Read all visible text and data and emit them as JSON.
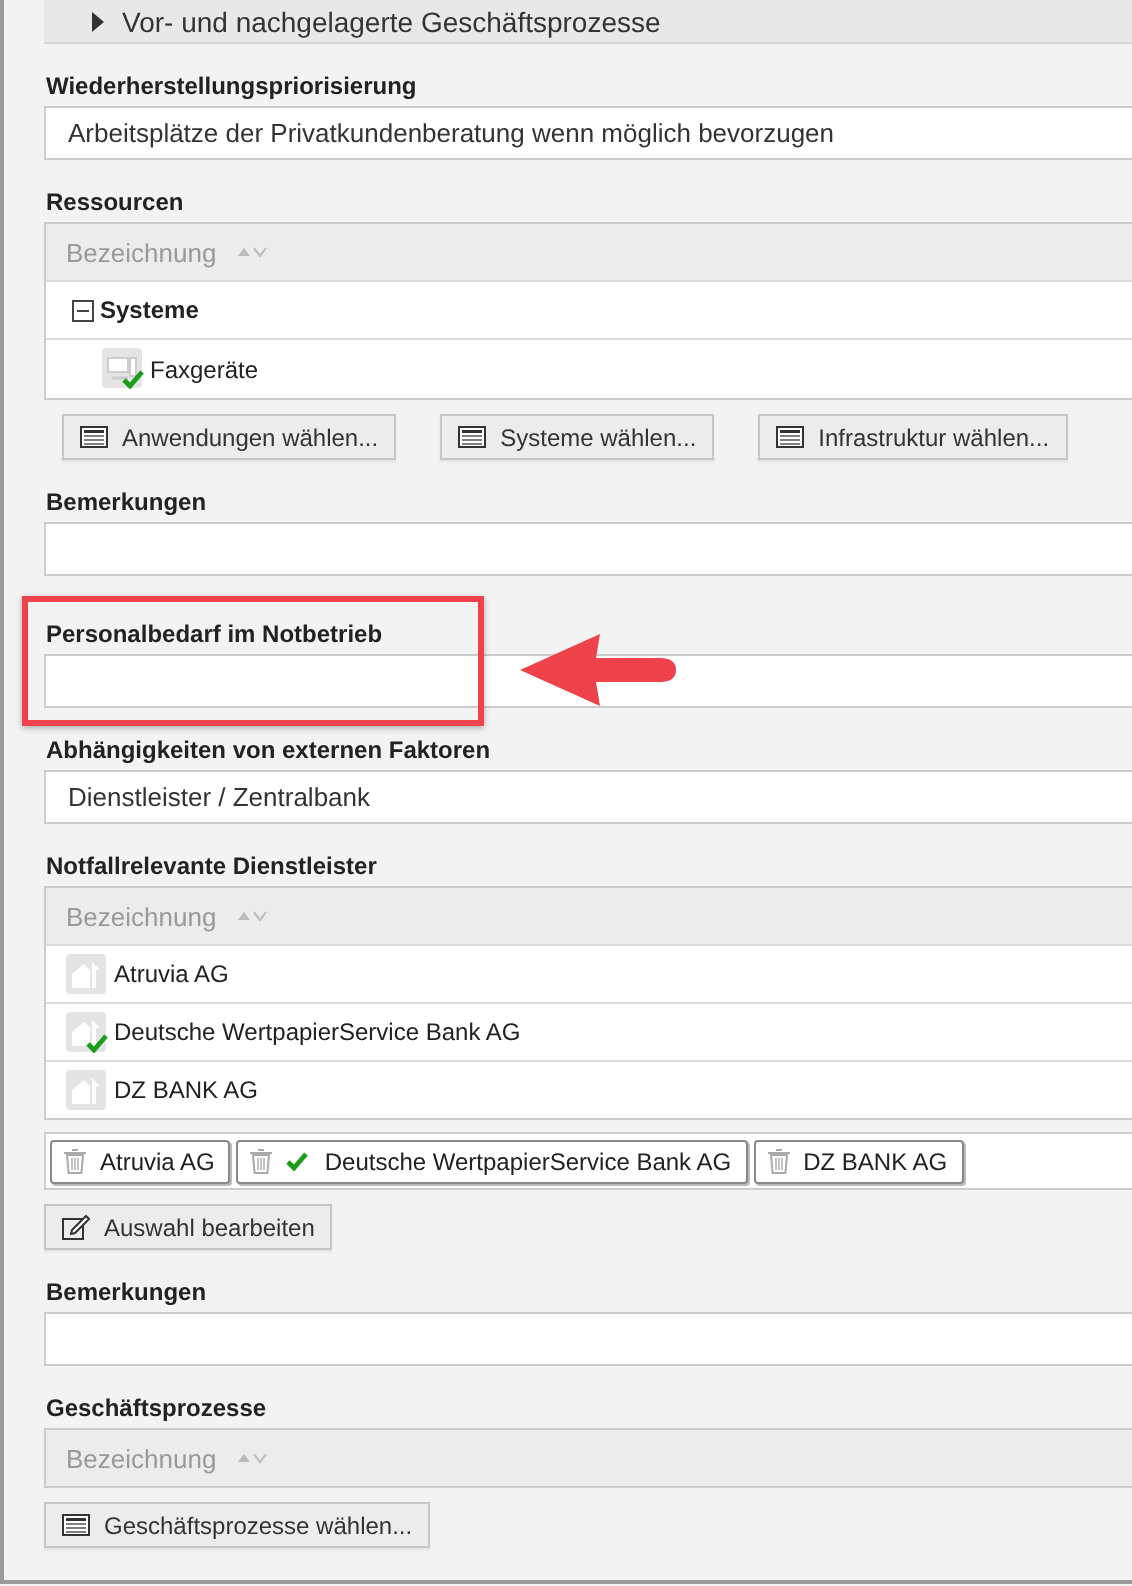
{
  "collapsible_section": {
    "title": "Vor- und nachgelagerte Geschäftsprozesse",
    "expanded": false
  },
  "fields": [
    {
      "kind": "text",
      "label": "Wiederherstellungspriorisierung",
      "value": "Arbeitsplätze der Privatkundenberatung wenn möglich bevorzugen",
      "highlighted": false
    },
    {
      "kind": "table",
      "label": "Ressourcen",
      "column": "Bezeichnung",
      "rows": [
        {
          "label": "Systeme",
          "expanded": true,
          "children": [
            {
              "label": "Faxgeräte",
              "verified": true
            }
          ]
        }
      ],
      "buttons": [
        "Anwendungen wählen...",
        "Systeme wählen...",
        "Infrastruktur wählen..."
      ]
    },
    {
      "kind": "text",
      "label": "Bemerkungen",
      "highlighted": false
    },
    {
      "kind": "text",
      "label": "Personalbedarf im Notbetrieb",
      "highlighted": true
    },
    {
      "kind": "text",
      "label": "Abhängigkeiten von externen Faktoren",
      "value": "Dienstleister / Zentralbank",
      "highlighted": false
    },
    {
      "kind": "providers",
      "label": "Notfallrelevante Dienstleister",
      "column": "Bezeichnung",
      "rows": [
        {
          "label": "Atruvia AG",
          "verified": false
        },
        {
          "label": "Deutsche WertpapierService Bank AG",
          "verified": true
        },
        {
          "label": "DZ BANK AG",
          "verified": false
        }
      ],
      "chips": [
        {
          "label": "Atruvia AG",
          "verified": false
        },
        {
          "label": "Deutsche WertpapierService Bank AG",
          "verified": true
        },
        {
          "label": "DZ BANK AG",
          "verified": false
        }
      ],
      "edit_button": "Auswahl bearbeiten"
    },
    {
      "kind": "text",
      "label": "Bemerkungen",
      "highlighted": false
    },
    {
      "kind": "table",
      "label": "Geschäftsprozesse",
      "column": "Bezeichnung",
      "buttons": [
        "Geschäftsprozesse wählen..."
      ]
    }
  ]
}
